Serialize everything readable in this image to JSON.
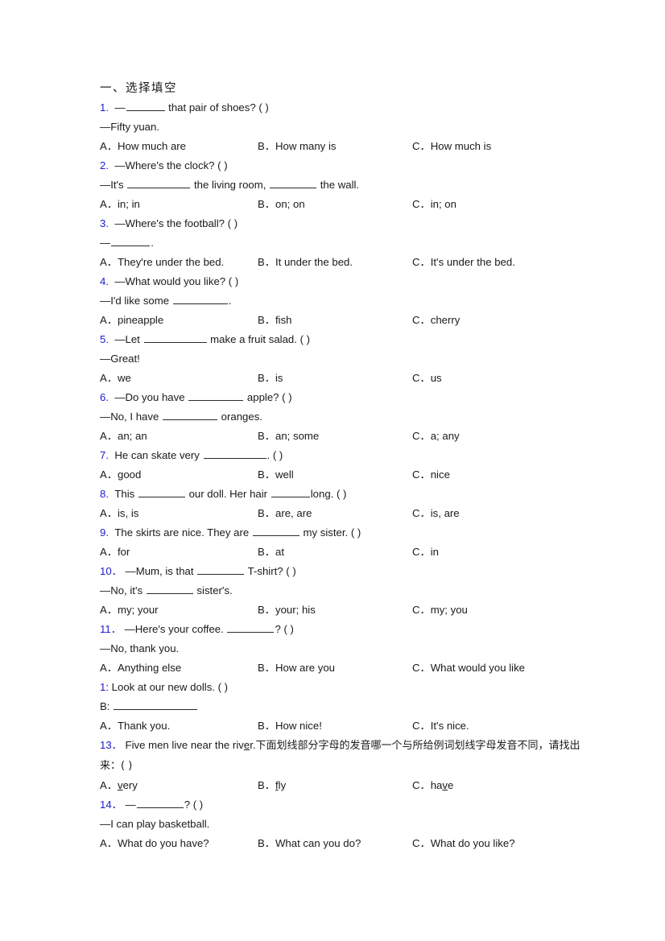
{
  "document": {
    "section_title": "一、选择填空",
    "number_color": "#1c1ccc",
    "text_color": "#1a1a1a",
    "background": "#ffffff"
  },
  "questions": [
    {
      "num": "1.",
      "stem_pre": "—",
      "blank": "b-s",
      "stem_post": " that pair of shoes? (    )",
      "answer_line": "—Fifty yuan.",
      "options": [
        {
          "letter": "A．",
          "text": "How much are"
        },
        {
          "letter": "B．",
          "text": "How many is"
        },
        {
          "letter": "C．",
          "text": "How much is"
        }
      ]
    },
    {
      "num": "2.",
      "stem": "—Where's the clock? (  )",
      "answer_pre": "—It's ",
      "answer_mid": " the living room, ",
      "answer_post": " the wall.",
      "options": [
        {
          "letter": "A．",
          "text": "in; in"
        },
        {
          "letter": "B．",
          "text": "on; on"
        },
        {
          "letter": "C．",
          "text": "in; on"
        }
      ]
    },
    {
      "num": "3.",
      "stem": "—Where's the football? (  )",
      "answer_pre": "—",
      "answer_post": ".",
      "options": [
        {
          "letter": "A．",
          "text": "They're under the bed."
        },
        {
          "letter": "B．",
          "text": "It under the bed."
        },
        {
          "letter": "C．",
          "text": "It's under the bed."
        }
      ]
    },
    {
      "num": "4.",
      "stem": "—What would you like? (  )",
      "answer_pre": "—I'd like some ",
      "answer_post": ".",
      "options": [
        {
          "letter": "A．",
          "text": "pineapple"
        },
        {
          "letter": "B．",
          "text": "fish"
        },
        {
          "letter": "C．",
          "text": "cherry"
        }
      ]
    },
    {
      "num": "5.",
      "stem_pre": "—Let ",
      "stem_post": " make a fruit salad. (  )",
      "answer_line": "—Great!",
      "options": [
        {
          "letter": "A．",
          "text": "we"
        },
        {
          "letter": "B．",
          "text": "is"
        },
        {
          "letter": "C．",
          "text": "us"
        }
      ]
    },
    {
      "num": "6.",
      "stem_pre": "—Do you have ",
      "stem_post": " apple? (    )",
      "answer_pre": "—No, I have ",
      "answer_post": " oranges.",
      "options": [
        {
          "letter": "A．",
          "text": "an; an"
        },
        {
          "letter": "B．",
          "text": "an; some"
        },
        {
          "letter": "C．",
          "text": "a; any"
        }
      ]
    },
    {
      "num": "7.",
      "stem_pre": "He can skate very ",
      "stem_post": ". (    )",
      "options": [
        {
          "letter": "A．",
          "text": "good"
        },
        {
          "letter": "B．",
          "text": "well"
        },
        {
          "letter": "C．",
          "text": "nice"
        }
      ]
    },
    {
      "num": "8.",
      "stem_pre": "This ",
      "stem_mid": " our doll. Her hair ",
      "stem_post": "long. (  )",
      "options": [
        {
          "letter": "A．",
          "text": "is, is"
        },
        {
          "letter": "B．",
          "text": "are, are"
        },
        {
          "letter": "C．",
          "text": "is, are"
        }
      ]
    },
    {
      "num": "9.",
      "stem_pre": "The skirts are nice. They are ",
      "stem_post": " my sister. (  )",
      "options": [
        {
          "letter": "A．",
          "text": "for"
        },
        {
          "letter": "B．",
          "text": "at"
        },
        {
          "letter": "C．",
          "text": "in"
        }
      ]
    },
    {
      "num": "10．",
      "stem_pre": "—Mum, is that ",
      "stem_post": " T-shirt? (  )",
      "answer_pre": "—No, it's ",
      "answer_post": " sister's.",
      "options": [
        {
          "letter": "A．",
          "text": "my; your"
        },
        {
          "letter": "B．",
          "text": "your; his"
        },
        {
          "letter": "C．",
          "text": "my; you"
        }
      ]
    },
    {
      "num": "11．",
      "stem_pre": "—Here's your coffee. ",
      "stem_post": "? (  )",
      "answer_line": "—No, thank you.",
      "options": [
        {
          "letter": "A．",
          "text": "Anything else"
        },
        {
          "letter": "B．",
          "text": "How are you"
        },
        {
          "letter": "C．",
          "text": "What would you like"
        }
      ]
    },
    {
      "num": "1",
      "num_suffix": ":",
      "stem_post": " Look at our new dolls. (  )",
      "answer_pre": "B: ",
      "options": [
        {
          "letter": "A．",
          "text": "Thank you."
        },
        {
          "letter": "B．",
          "text": "How nice!"
        },
        {
          "letter": "C．",
          "text": "It's nice."
        }
      ]
    },
    {
      "num": "13．",
      "stem_en_pre": "Five men live near the riv",
      "stem_en_ul": "e",
      "stem_en_post": "r.",
      "stem_cn": "下面划线部分字母的发音哪一个与所给例词划线字母发音不同，请找出来：(  )",
      "options": [
        {
          "letter": "A．",
          "ul": "v",
          "text": "ery",
          "ul_pos": "start"
        },
        {
          "letter": "B．",
          "ul": "f",
          "text": "ly",
          "ul_pos": "start"
        },
        {
          "letter": "C．",
          "pre": "ha",
          "ul": "v",
          "text": "e",
          "ul_pos": "mid"
        }
      ]
    },
    {
      "num": "14．",
      "stem_pre": "—",
      "stem_post": "? (  )",
      "answer_line": "—I can play basketball.",
      "options": [
        {
          "letter": "A．",
          "text": "What do you have?"
        },
        {
          "letter": "B．",
          "text": "What can you do?"
        },
        {
          "letter": "C．",
          "text": "What do you like?"
        }
      ]
    }
  ]
}
